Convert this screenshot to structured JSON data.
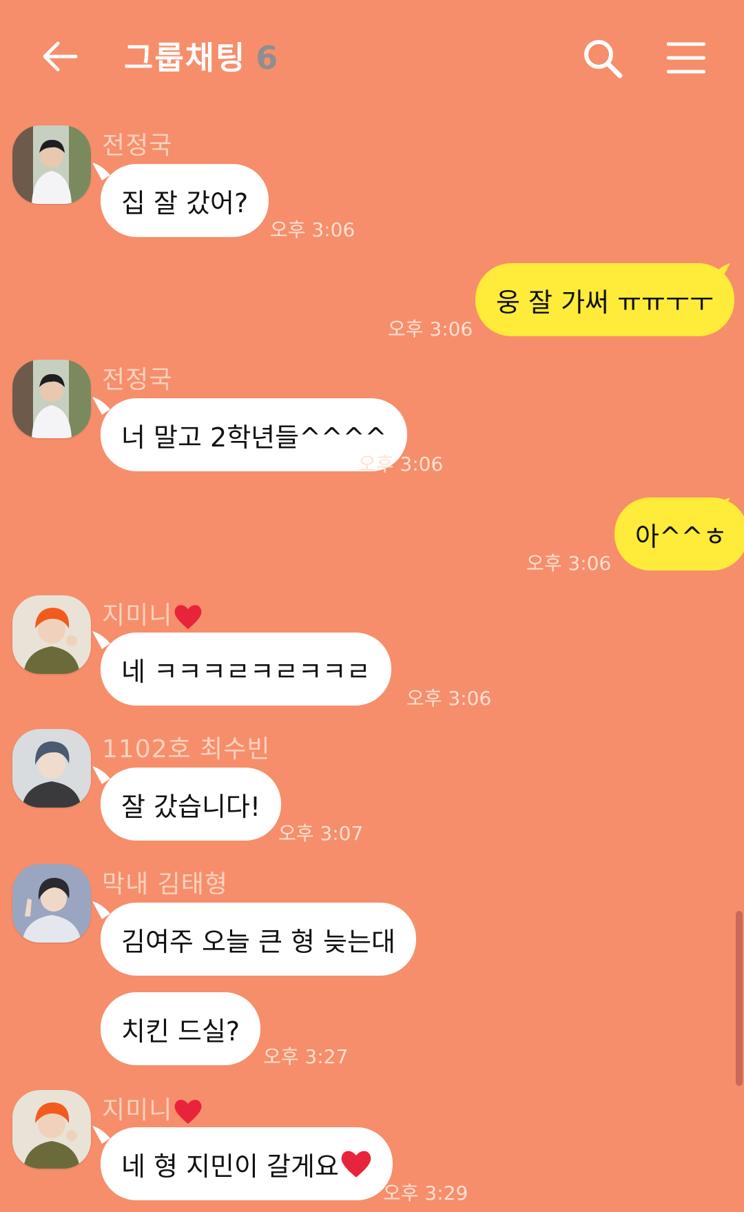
{
  "header": {
    "title": "그룹채팅",
    "member_count": "6",
    "back_icon": "arrow-left-icon",
    "search_icon": "search-icon",
    "menu_icon": "hamburger-menu-icon"
  },
  "colors": {
    "background": "#F68E6B",
    "my_bubble": "#FEEB3A",
    "other_bubble": "#FFFFFF",
    "heart": "#E8243A"
  },
  "messages": [
    {
      "sender": "전정국",
      "text": "집 잘 갔어?",
      "time": "오후 3:06",
      "mine": false
    },
    {
      "text": "웅 잘 가써 ㅠㅠㅜㅜ",
      "time": "오후 3:06",
      "mine": true
    },
    {
      "sender": "전정국",
      "text": "너 말고 2학년들^^^^",
      "time": "오후 3:06",
      "mine": false
    },
    {
      "text": "아^^ㅎ",
      "time": "오후 3:06",
      "mine": true
    },
    {
      "sender": "지미니",
      "text": "네 ㅋㅋㅋㄹㅋㄹㅋㅋㄹ",
      "time": "오후 3:06",
      "mine": false
    },
    {
      "sender": "1102호 최수빈",
      "text": "잘 갔습니다!",
      "time": "오후 3:07",
      "mine": false
    },
    {
      "sender": "막내 김태형",
      "text": "김여주 오늘 큰 형 늦는대",
      "mine": false
    },
    {
      "text": "치킨 드실?",
      "time": "오후 3:27",
      "mine": false
    },
    {
      "sender": "지미니",
      "text": "네 형 지민이 갈게요",
      "time": "오후 3:29",
      "mine": false
    }
  ]
}
